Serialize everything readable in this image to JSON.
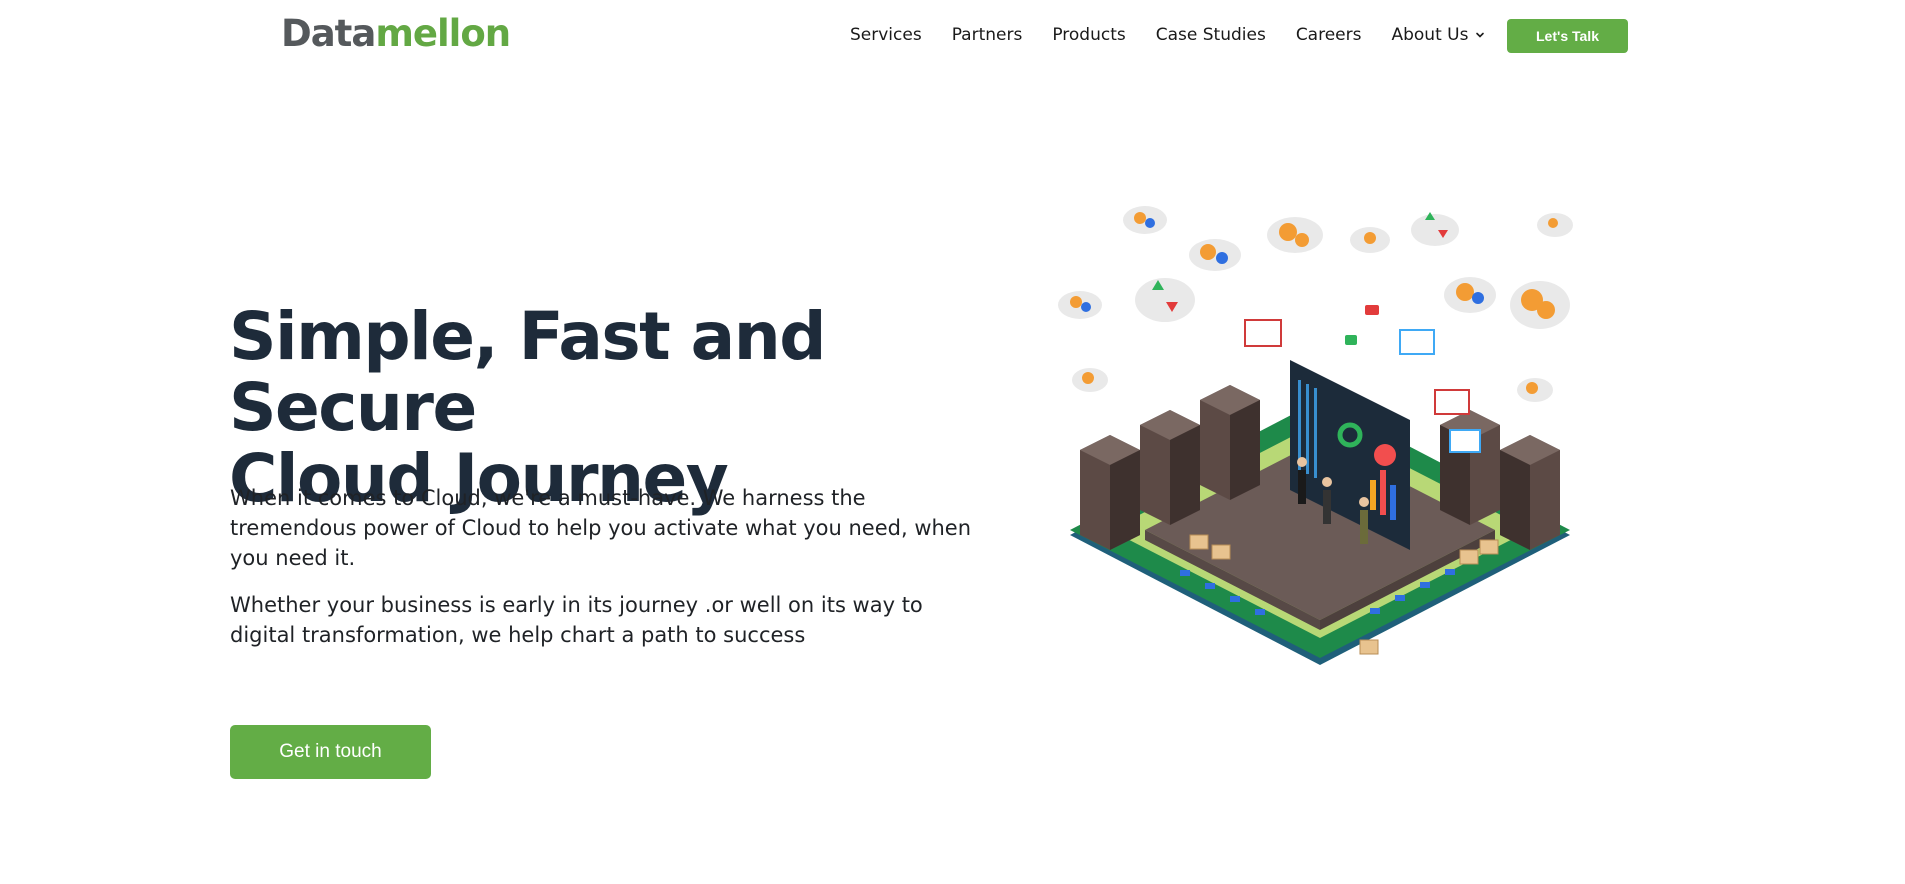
{
  "header": {
    "logo_part1": "Data",
    "logo_part2": "mellon",
    "nav": [
      {
        "label": "Services"
      },
      {
        "label": "Partners"
      },
      {
        "label": "Products"
      },
      {
        "label": "Case Studies"
      },
      {
        "label": "Careers"
      },
      {
        "label": "About Us"
      }
    ],
    "cta_label": "Let's Talk"
  },
  "hero": {
    "title_line1": "Simple, Fast and Secure",
    "title_line2": "Cloud Journey",
    "paragraph1": "When it comes to Cloud, we're a must-have. We harness the tremendous power of Cloud to help you activate what you need, when you need it.",
    "paragraph2": "Whether your business is early in its journey .or well on its way to digital transformation, we help chart a path to success",
    "cta_label": "Get in touch"
  },
  "colors": {
    "brand_green": "#63ad46",
    "logo_grey": "#55595c",
    "heading": "#1e2b3a"
  },
  "icons": {
    "dropdown": "chevron-down-icon"
  }
}
